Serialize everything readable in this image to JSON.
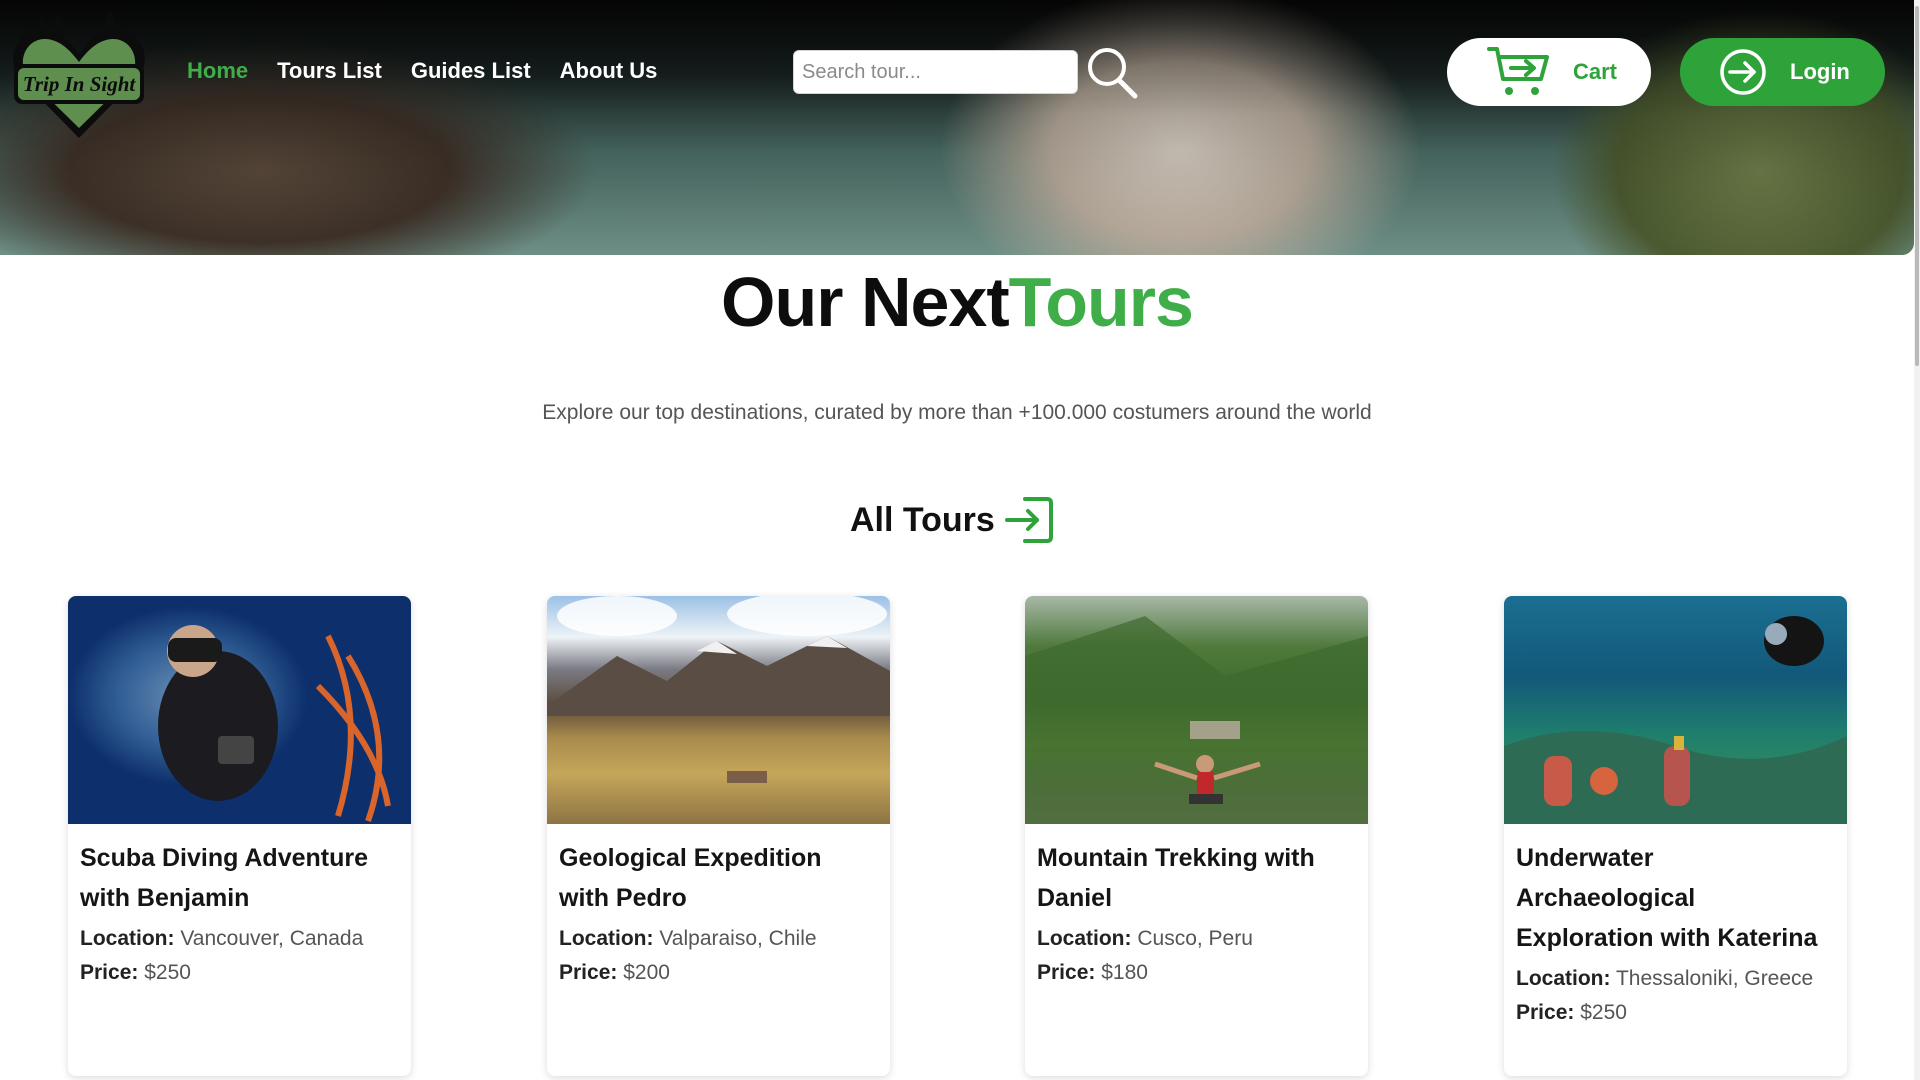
{
  "header": {
    "logo_text": "Trip In Sight",
    "nav": [
      {
        "label": "Home",
        "active": true
      },
      {
        "label": "Tours List",
        "active": false
      },
      {
        "label": "Guides List",
        "active": false
      },
      {
        "label": "About Us",
        "active": false
      }
    ],
    "search": {
      "placeholder": "Search tour...",
      "value": ""
    },
    "cart_label": "Cart",
    "login_label": "Login"
  },
  "main": {
    "title_part1": "Our Next",
    "title_part2": "Tours",
    "subtitle": "Explore our top destinations, curated by more than +100.000 costumers around the world",
    "all_tours_label": "All Tours"
  },
  "tours": [
    {
      "name": "Scuba Diving Adventure with Benjamin",
      "location_label": "Location:",
      "location": "Vancouver, Canada",
      "price_label": "Price:",
      "price": "$250"
    },
    {
      "name": "Geological Expedition with Pedro",
      "location_label": "Location:",
      "location": "Valparaiso, Chile",
      "price_label": "Price:",
      "price": "$200"
    },
    {
      "name": "Mountain Trekking with Daniel",
      "location_label": "Location:",
      "location": "Cusco, Peru",
      "price_label": "Price:",
      "price": "$180"
    },
    {
      "name": "Underwater Archaeological Exploration with Katerina",
      "location_label": "Location:",
      "location": "Thessaloniki, Greece",
      "price_label": "Price:",
      "price": "$250"
    }
  ],
  "colors": {
    "brand_green": "#3fae49",
    "button_green": "#2ea33a",
    "text_dark": "#111111",
    "text_muted": "#555555"
  },
  "icons": [
    "logo-icon",
    "search-icon",
    "cart-icon",
    "login-arrow-icon",
    "enter-arrow-icon"
  ]
}
